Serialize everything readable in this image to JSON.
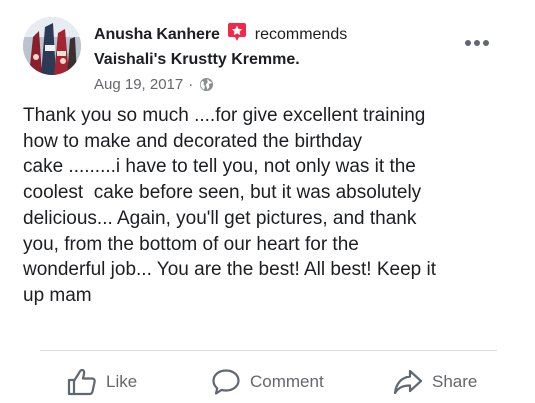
{
  "post": {
    "author": "Anusha Kanhere",
    "action": "recommends",
    "page_name": "Vaishali's Krustty Kremme.",
    "date": "Aug 19, 2017",
    "separator": "·",
    "privacy_icon": "globe-icon",
    "menu_icon": "more-dots-icon",
    "recommend_icon": "recommend-badge-icon",
    "recommend_color": "#f02849",
    "body": "Thank you so much ....for give excellent training\nhow to make and decorated the birthday\ncake .........i have to tell you, not only was it the\ncoolest  cake before seen, but it was absolutely\ndelicious... Again, you'll get pictures, and thank\nyou, from the bottom of our heart for the\nwonderful job... You are the best! All best! Keep it\nup mam"
  },
  "actions": {
    "like_label": "Like",
    "like_icon": "thumbs-up-icon",
    "comment_label": "Comment",
    "comment_icon": "comment-bubble-icon",
    "share_label": "Share",
    "share_icon": "share-arrow-icon"
  },
  "colors": {
    "text_primary": "#1c1e21",
    "text_secondary": "#65676b",
    "divider": "#dadde1"
  }
}
